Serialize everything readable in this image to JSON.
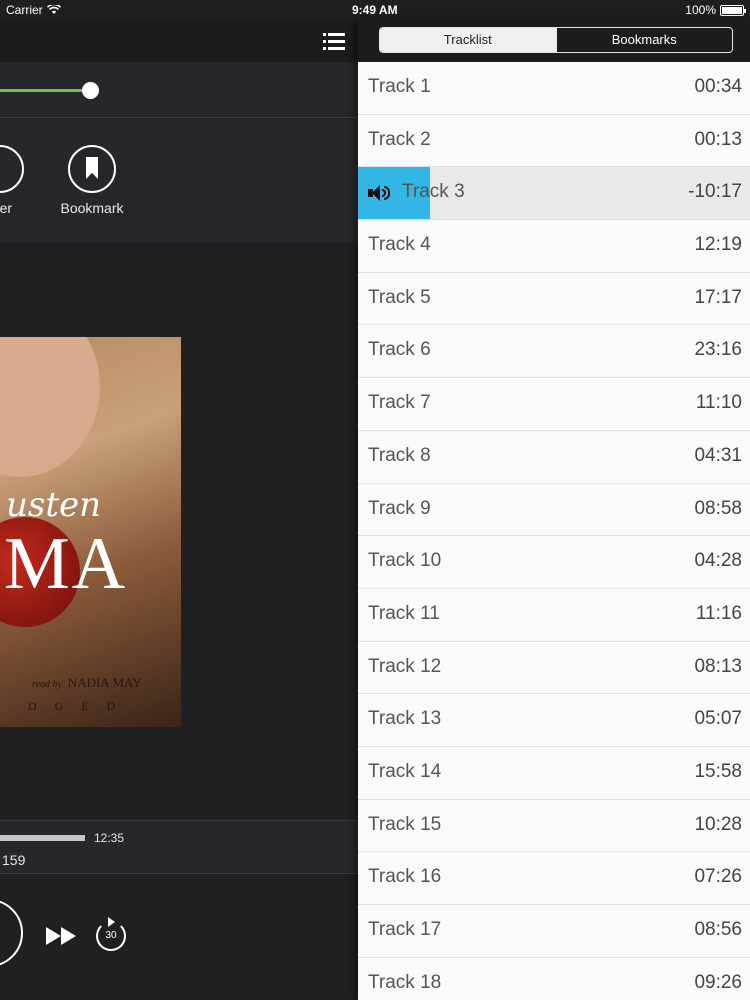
{
  "status_bar": {
    "carrier": "Carrier",
    "time": "9:49 AM",
    "battery": "100%",
    "battery_level": 1.0
  },
  "player": {
    "position_fraction": 0.25,
    "actions": {
      "timer_label": "mer",
      "bookmark_label": "Bookmark"
    },
    "cover": {
      "author_script": "usten",
      "title_fragment": "MA",
      "reader_prefix": "read by",
      "reader_name": "NADIA MAY",
      "abridged_fragment": "DGED"
    },
    "progress": {
      "total": "12:35",
      "current": "159"
    },
    "skip_seconds": "30"
  },
  "tabs": {
    "tracklist": "Tracklist",
    "bookmarks": "Bookmarks",
    "active": "tracklist"
  },
  "tracks": [
    {
      "name": "Track 1",
      "time": "00:34"
    },
    {
      "name": "Track 2",
      "time": "00:13"
    },
    {
      "name": "Track 3",
      "time": "-10:17",
      "current": true
    },
    {
      "name": "Track 4",
      "time": "12:19"
    },
    {
      "name": "Track 5",
      "time": "17:17"
    },
    {
      "name": "Track 6",
      "time": "23:16"
    },
    {
      "name": "Track 7",
      "time": "11:10"
    },
    {
      "name": "Track 8",
      "time": "04:31"
    },
    {
      "name": "Track 9",
      "time": "08:58"
    },
    {
      "name": "Track 10",
      "time": "04:28"
    },
    {
      "name": "Track 11",
      "time": "11:16"
    },
    {
      "name": "Track 12",
      "time": "08:13"
    },
    {
      "name": "Track 13",
      "time": "05:07"
    },
    {
      "name": "Track 14",
      "time": "15:58"
    },
    {
      "name": "Track 15",
      "time": "10:28"
    },
    {
      "name": "Track 16",
      "time": "07:26"
    },
    {
      "name": "Track 17",
      "time": "08:56"
    },
    {
      "name": "Track 18",
      "time": "09:26"
    }
  ],
  "colors": {
    "accent_green": "#7bc043",
    "now_playing_blue": "#33b5e5",
    "dark_bg": "#1f2022"
  },
  "icons": {
    "menu": "list-menu-icon",
    "bookmark": "bookmark-icon",
    "speaker": "speaker-icon",
    "fast_forward": "fast-forward-icon",
    "skip": "skip-forward-30-icon"
  }
}
